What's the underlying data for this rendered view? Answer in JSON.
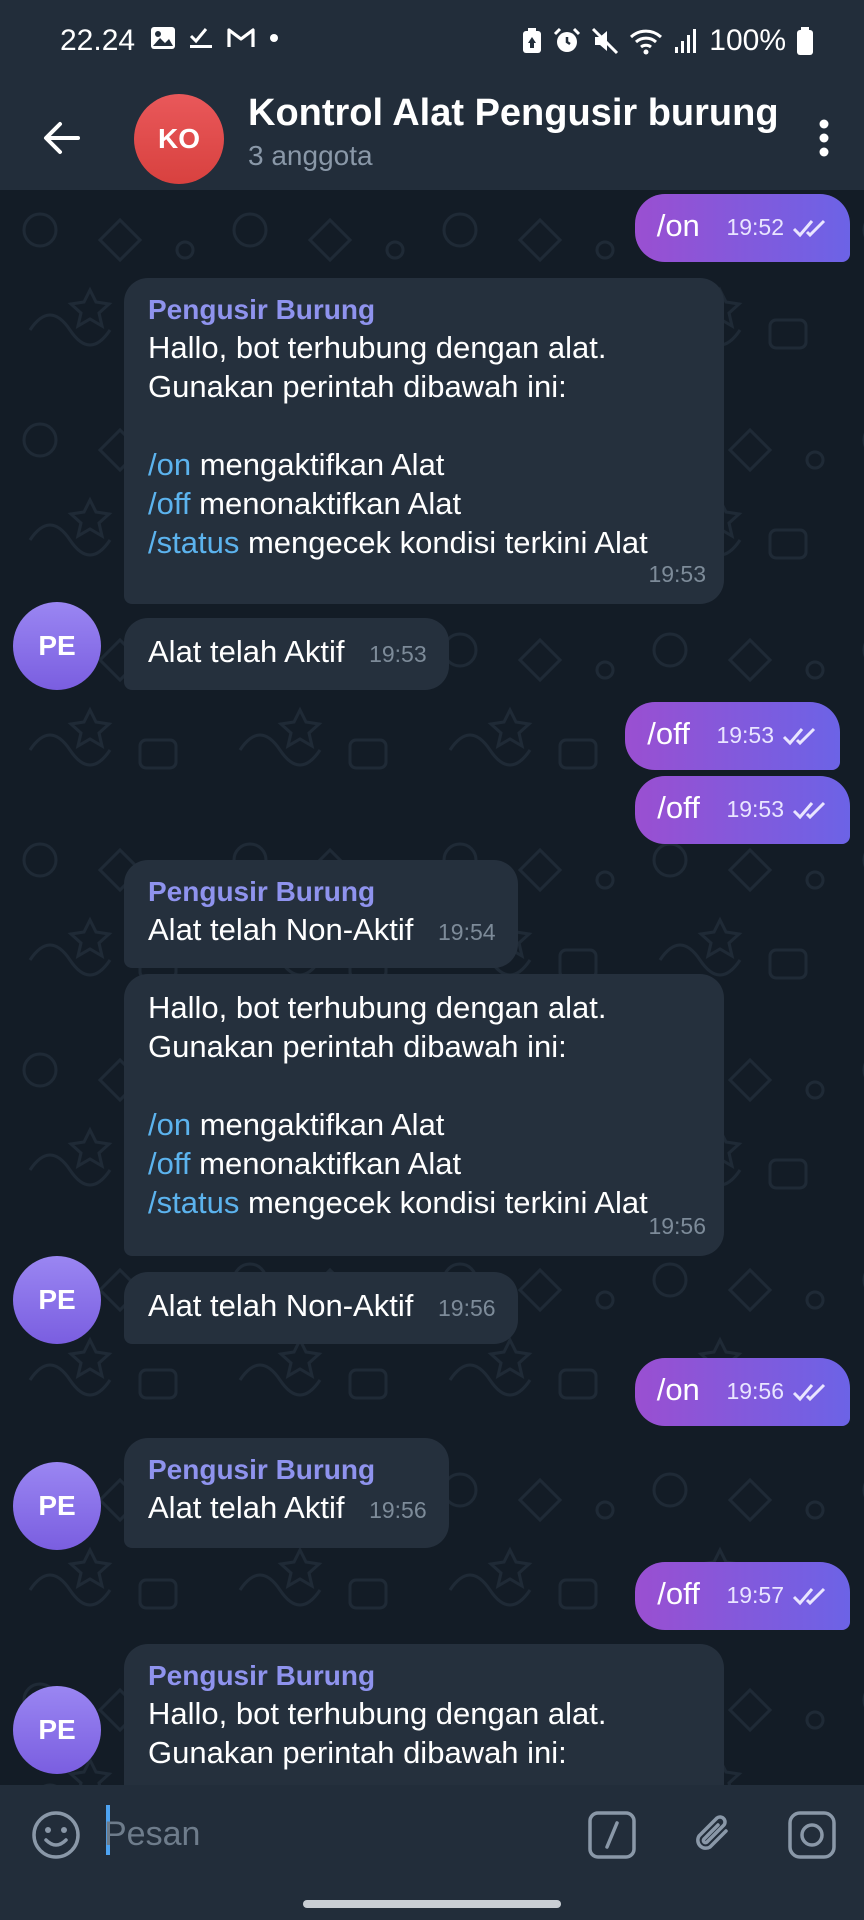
{
  "status_bar": {
    "time": "22.24",
    "battery": "100%"
  },
  "header": {
    "avatar_initials": "KO",
    "title": "Kontrol Alat Pengusir burung",
    "subtitle": "3 anggota"
  },
  "messages": {
    "m1": {
      "text": "/on",
      "time": "19:52"
    },
    "m2": {
      "sender": "Pengusir Burung",
      "line1": "Hallo, bot terhubung dengan alat.",
      "line2": "Gunakan perintah dibawah ini:",
      "cmd1": "/on",
      "desc1": " mengaktifkan Alat",
      "cmd2": "/off",
      "desc2": " menonaktifkan Alat",
      "cmd3": "/status",
      "desc3": " mengecek kondisi terkini Alat",
      "time": "19:53"
    },
    "m3": {
      "avatar": "PE",
      "text": "Alat telah Aktif",
      "time": "19:53"
    },
    "m4": {
      "text": "/off",
      "time": "19:53"
    },
    "m5": {
      "text": "/off",
      "time": "19:53"
    },
    "m6": {
      "sender": "Pengusir Burung",
      "text": "Alat telah Non-Aktif",
      "time": "19:54"
    },
    "m7": {
      "line1": "Hallo, bot terhubung dengan alat.",
      "line2": "Gunakan perintah dibawah ini:",
      "cmd1": "/on",
      "desc1": " mengaktifkan Alat",
      "cmd2": "/off",
      "desc2": " menonaktifkan Alat",
      "cmd3": "/status",
      "desc3": " mengecek kondisi terkini Alat",
      "time": "19:56"
    },
    "m8": {
      "avatar": "PE",
      "text": "Alat telah Non-Aktif",
      "time": "19:56"
    },
    "m9": {
      "text": "/on",
      "time": "19:56"
    },
    "m10": {
      "avatar": "PE",
      "sender": "Pengusir Burung",
      "text": "Alat telah Aktif",
      "time": "19:56"
    },
    "m11": {
      "text": "/off",
      "time": "19:57"
    },
    "m12": {
      "avatar": "PE",
      "sender": "Pengusir Burung",
      "line1": "Hallo, bot terhubung dengan alat.",
      "line2": "Gunakan perintah dibawah ini:"
    }
  },
  "input": {
    "placeholder": "Pesan"
  },
  "icons": {
    "back": "arrow-left-icon",
    "menu": "more-vertical-icon",
    "emoji": "emoji-icon",
    "commands": "bot-commands-icon",
    "attach": "paperclip-icon",
    "camera": "camera-icon",
    "read": "double-check-icon"
  },
  "colors": {
    "outgoing_start": "#9a4fd1",
    "outgoing_end": "#6c63e6",
    "incoming": "#25303d",
    "sender_name": "#8f93ee",
    "command_link": "#5cb3ee"
  }
}
